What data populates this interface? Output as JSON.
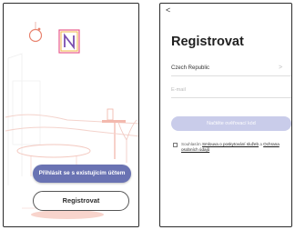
{
  "welcome_screen": {
    "login_button_label": "Přihlásit se s existujícím účtem",
    "register_button_label": "Registrovat"
  },
  "register_screen": {
    "back_glyph": "<",
    "title": "Registrovat",
    "country_value": "Czech Republic",
    "email_placeholder": "E-mail",
    "code_button_label": "Načtěte ověřovací kód",
    "consent_prefix": "Souhlasím ",
    "consent_link_terms": "Smlouva o poskytování služeb",
    "consent_and": " a ",
    "consent_link_privacy": "Ochrana osobních údajů"
  },
  "colors": {
    "primary": "#6a73b3",
    "primary_disabled": "#c9ccea",
    "illustration_pink": "#f3b9ae",
    "logo_purple": "#7b4fb0"
  }
}
